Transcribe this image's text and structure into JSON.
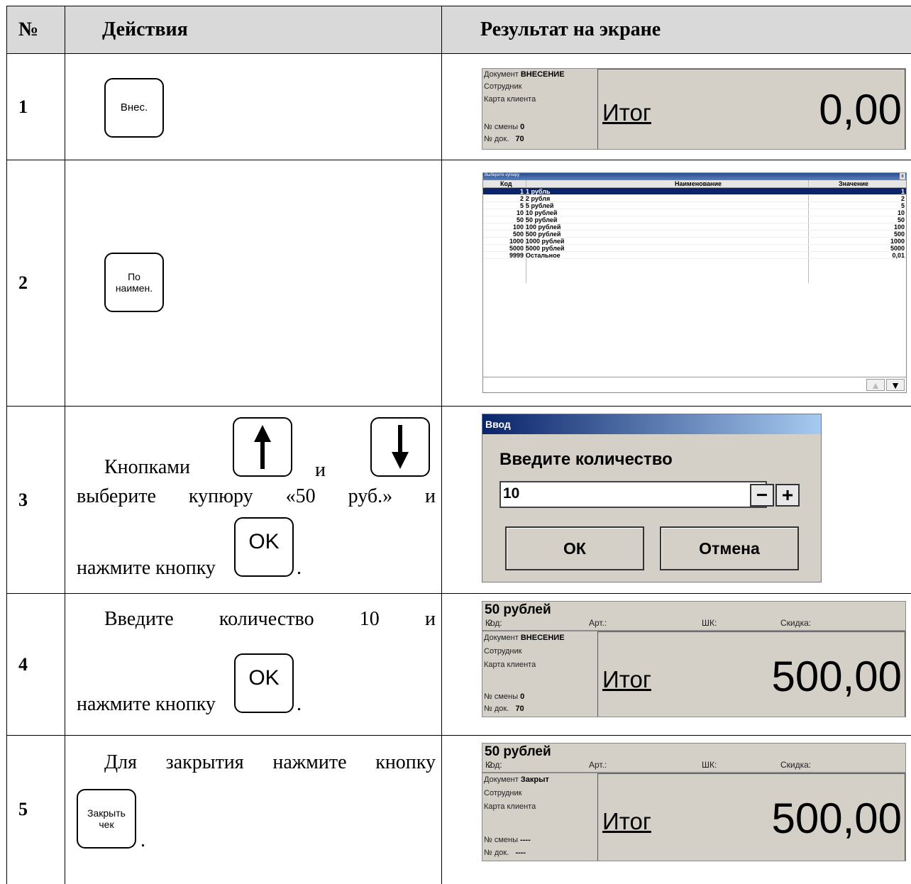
{
  "header": {
    "num": "№",
    "actions": "Действия",
    "result": "Результат на экране"
  },
  "rows": [
    {
      "num": "1",
      "key": "Внес."
    },
    {
      "num": "2",
      "key_line1": "По",
      "key_line2": "наимен."
    },
    {
      "num": "3",
      "text_a": "Кнопками",
      "text_and": "и",
      "text_b": "выберите купюру «50 руб.» и",
      "text_c": "нажмите кнопку",
      "ok": "OK",
      "dot": "."
    },
    {
      "num": "4",
      "text_a": "Введите количество 10 и",
      "text_c": "нажмите кнопку",
      "ok": "OK",
      "dot": "."
    },
    {
      "num": "5",
      "text_a": "Для закрытия нажмите кнопку",
      "key_line1": "Закрыть",
      "key_line2": "чек",
      "dot": "."
    }
  ],
  "screen1": {
    "doc_label": "Документ",
    "doc_value": "ВНЕСЕНИЕ",
    "employee": "Сотрудник",
    "card": "Карта клиента",
    "shift_label": "№ смены",
    "shift_value": "0",
    "docnum_label": "№ док.",
    "docnum_value": "70",
    "itog": "Итог",
    "total": "0,00"
  },
  "selector": {
    "title": "Выберите купюру",
    "close": "x",
    "col_code": "Код",
    "col_name": "Наименование",
    "col_value": "Значение",
    "items": [
      {
        "code": "1",
        "name": "1 рубль",
        "value": "1"
      },
      {
        "code": "2",
        "name": "2 рубля",
        "value": "2"
      },
      {
        "code": "5",
        "name": "5 рублей",
        "value": "5"
      },
      {
        "code": "10",
        "name": "10 рублей",
        "value": "10"
      },
      {
        "code": "50",
        "name": "50 рублей",
        "value": "50"
      },
      {
        "code": "100",
        "name": "100 рублей",
        "value": "100"
      },
      {
        "code": "500",
        "name": "500 рублей",
        "value": "500"
      },
      {
        "code": "1000",
        "name": "1000 рублей",
        "value": "1000"
      },
      {
        "code": "5000",
        "name": "5000 рублей",
        "value": "5000"
      },
      {
        "code": "9999",
        "name": "Остальное",
        "value": "0,01"
      }
    ]
  },
  "dialog": {
    "title": "Ввод",
    "prompt": "Введите количество",
    "value": "10",
    "minus": "−",
    "plus": "+",
    "ok": "ОК",
    "cancel": "Отмена"
  },
  "screen4": {
    "item": "50 рублей",
    "code_label": "Код:",
    "code_value": "2",
    "art_label": "Арт.:",
    "barcode_label": "ШК:",
    "discount_label": "Скидка:",
    "doc_label": "Документ",
    "doc_value": "ВНЕСЕНИЕ",
    "employee": "Сотрудник",
    "card": "Карта клиента",
    "shift_label": "№ смены",
    "shift_value": "0",
    "docnum_label": "№ док.",
    "docnum_value": "70",
    "itog": "Итог",
    "total": "500,00"
  },
  "screen5": {
    "item": "50 рублей",
    "code_label": "Код:",
    "code_value": "2",
    "art_label": "Арт.:",
    "barcode_label": "ШК:",
    "discount_label": "Скидка:",
    "doc_label": "Документ",
    "doc_value": "Закрыт",
    "employee": "Сотрудник",
    "card": "Карта клиента",
    "shift_label": "№ смены",
    "shift_value": "----",
    "docnum_label": "№ док.",
    "docnum_value": "----",
    "itog": "Итог",
    "total": "500,00"
  }
}
